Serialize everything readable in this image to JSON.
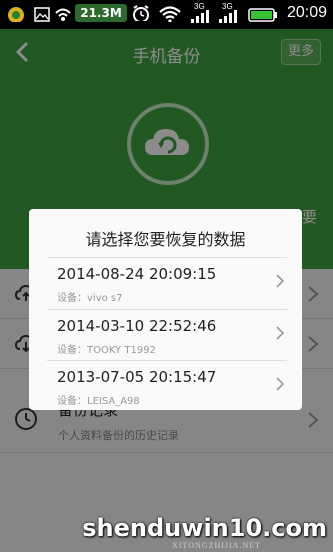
{
  "status_bar": {
    "net_speed": "21.3M",
    "signal_label": "3G",
    "time": "20:09"
  },
  "header": {
    "title": "手机备份",
    "more_label": "更多",
    "partial_right": "要"
  },
  "background_list": [
    {
      "title": "",
      "subtitle": "",
      "icon": "cloud-upload-icon"
    },
    {
      "title": "",
      "subtitle": "",
      "icon": "cloud-download-icon"
    },
    {
      "title": "备份记录",
      "subtitle": "个人资料备份的历史记录",
      "icon": "clock-icon"
    }
  ],
  "modal": {
    "title": "请选择您要恢复的数据",
    "items": [
      {
        "date": "2014-08-24 20:09:15",
        "device": "设备：vivo s7"
      },
      {
        "date": "2014-03-10 22:52:46",
        "device": "设备：TOOKY T1992"
      },
      {
        "date": "2013-07-05 20:15:47",
        "device": "设备：LEISA_A98"
      }
    ]
  },
  "watermark": {
    "text": "shenduwin10.com",
    "sub": "XITONGZHIJIA.NET"
  },
  "colors": {
    "header_green": "#3ea03e",
    "status_black": "#000000"
  }
}
